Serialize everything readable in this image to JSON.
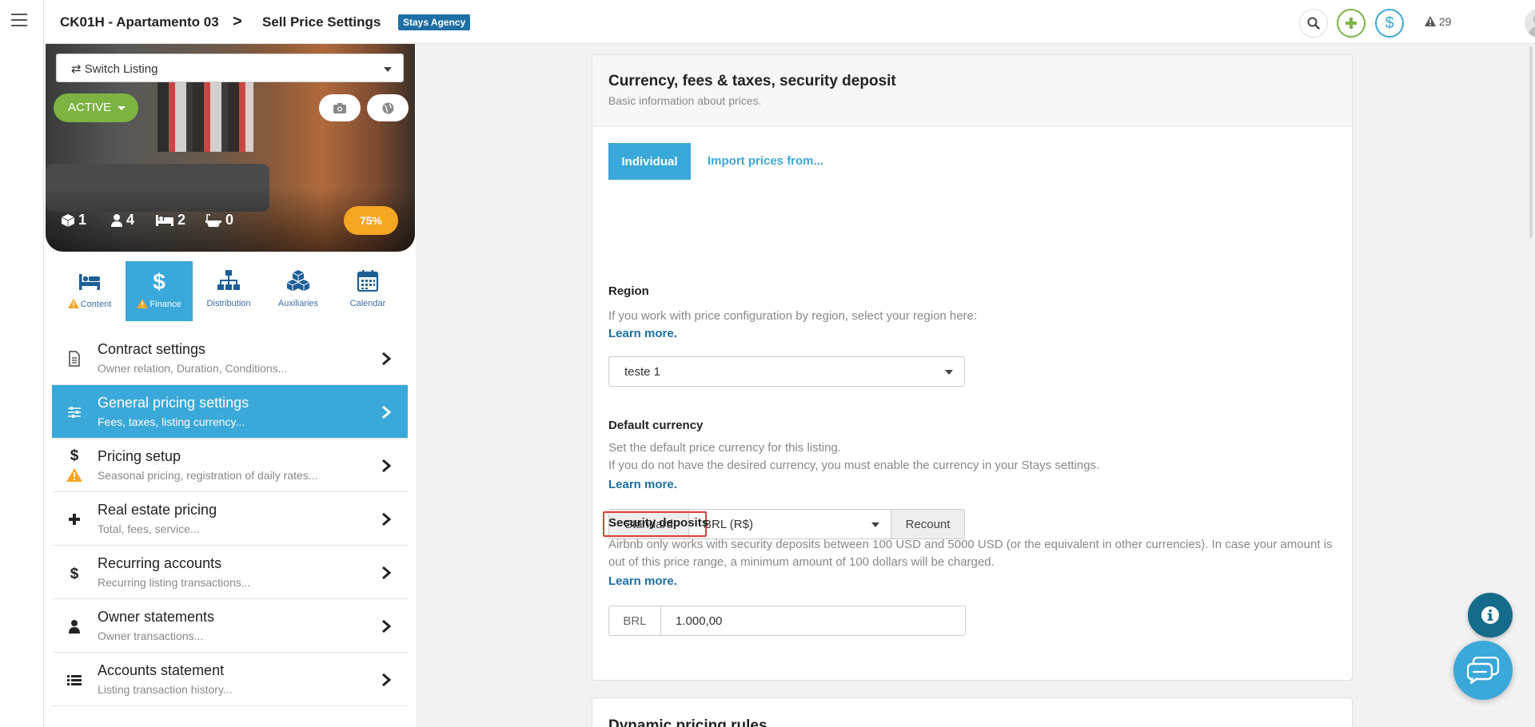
{
  "header": {
    "listing_name": "CK01H - Apartamento 03",
    "separator": ">",
    "page_title": "Sell Price Settings",
    "agency_badge": "Stays Agency",
    "alerts_count": "29"
  },
  "sidebar": {
    "switch_listing_label": "⇄ Switch Listing",
    "status_label": "ACTIVE",
    "stats": {
      "units": "1",
      "guests": "4",
      "beds": "2",
      "baths": "0"
    },
    "progress": "75%",
    "tabs": [
      {
        "label": "Content",
        "warning": true
      },
      {
        "label": "Finance",
        "warning": true
      },
      {
        "label": "Distribution",
        "warning": false
      },
      {
        "label": "Auxiliaries",
        "warning": false
      },
      {
        "label": "Calendar",
        "warning": false
      }
    ],
    "menu": [
      {
        "title": "Contract settings",
        "subtitle": "Owner relation, Duration, Conditions..."
      },
      {
        "title": "General pricing settings",
        "subtitle": "Fees, taxes, listing currency..."
      },
      {
        "title": "Pricing setup",
        "subtitle": "Seasonal pricing, registration of daily rates..."
      },
      {
        "title": "Real estate pricing",
        "subtitle": "Total, fees, service..."
      },
      {
        "title": "Recurring accounts",
        "subtitle": "Recurring listing transactions..."
      },
      {
        "title": "Owner statements",
        "subtitle": "Owner transactions..."
      },
      {
        "title": "Accounts statement",
        "subtitle": "Listing transaction history..."
      }
    ]
  },
  "main": {
    "card_title": "Currency, fees & taxes, security deposit",
    "card_subtitle": "Basic information about prices.",
    "btn_individual": "Individual",
    "link_import": "Import prices from...",
    "region": {
      "label": "Region",
      "text": "If you work with price configuration by region, select your region here:",
      "learn_more": "Learn more.",
      "selected": "teste 1"
    },
    "currency": {
      "label": "Default currency",
      "text1": "Set the default price currency for this listing.",
      "text2": "If you do not have the desired currency, you must enable the currency in your Stays settings.",
      "learn_more": "Learn more.",
      "standard_label": "Standard",
      "selected": "BRL (R$)",
      "recount_label": "Recount"
    },
    "security": {
      "label": "Security deposits",
      "text": "Airbnb only works with security deposits between 100 USD and 5000 USD (or the equivalent in other currencies). In case your amount is out of this price range, a minimum amount of 100 dollars will be charged.",
      "learn_more": "Learn more.",
      "prefix": "BRL",
      "value": "1.000,00"
    },
    "next_card_title": "Dynamic pricing rules"
  },
  "colors": {
    "accent": "#3aa8d8",
    "active_green": "#7cb342",
    "warning": "#f5a623",
    "highlight_red": "#e23b3b"
  }
}
